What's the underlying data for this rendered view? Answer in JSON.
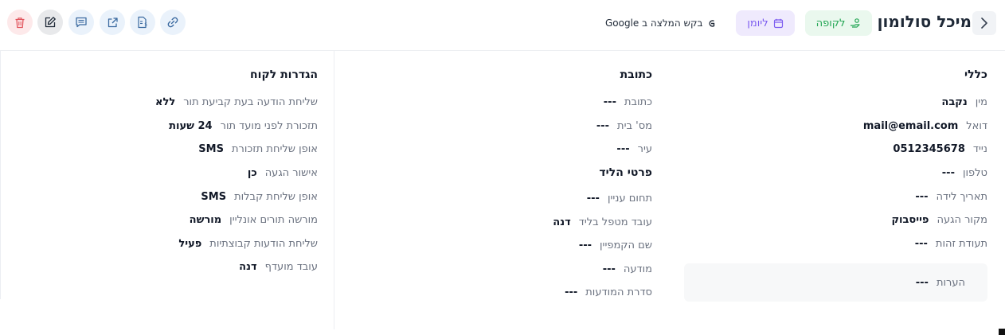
{
  "header": {
    "client_name": "מיכל סולומון",
    "customer_badge": "לקופה",
    "diary_badge": "ליומן",
    "google_request": "בקש המלצה ב Google"
  },
  "general": {
    "title": "כללי",
    "fields": [
      {
        "label": "מין",
        "value": "נקבה"
      },
      {
        "label": "דואל",
        "value": "mail@email.com"
      },
      {
        "label": "נייד",
        "value": "0512345678"
      },
      {
        "label": "טלפון",
        "value": "---"
      },
      {
        "label": "תאריך לידה",
        "value": "---"
      },
      {
        "label": "מקור הגעה",
        "value": "פייסבוק"
      },
      {
        "label": "תעודת זהות",
        "value": "---"
      }
    ],
    "notes_label": "הערות",
    "notes_value": "---"
  },
  "address": {
    "title": "כתובת",
    "fields": [
      {
        "label": "כתובת",
        "value": "---"
      },
      {
        "label": "מס' בית",
        "value": "---"
      },
      {
        "label": "עיר",
        "value": "---"
      }
    ]
  },
  "lead": {
    "title": "פרטי הליד",
    "fields": [
      {
        "label": "תחום עניין",
        "value": "---"
      },
      {
        "label": "עובד מטפל בליד",
        "value": "דנה"
      },
      {
        "label": "שם הקמפיין",
        "value": "---"
      },
      {
        "label": "מודעה",
        "value": "---"
      },
      {
        "label": "סדרת המודעות",
        "value": "---"
      }
    ]
  },
  "settings": {
    "title": "הגדרות לקוח",
    "fields": [
      {
        "label": "שליחת הודעה בעת קביעת תור",
        "value": "ללא"
      },
      {
        "label": "תזכורת לפני מועד תור",
        "value": "24 שעות"
      },
      {
        "label": "אופן שליחת תזכורת",
        "value": "SMS"
      },
      {
        "label": "אישור הגעה",
        "value": "כן"
      },
      {
        "label": "אופן שליחת קבלות",
        "value": "SMS"
      },
      {
        "label": "מורשה תורים אונליין",
        "value": "מורשה"
      },
      {
        "label": "שליחת הודעות קבוצתיות",
        "value": "פעיל"
      },
      {
        "label": "עובד מועדף",
        "value": "דנה"
      }
    ]
  },
  "icons": {
    "back": "chevron-right-icon",
    "customer": "hand-coin-icon",
    "diary": "calendar-icon",
    "google": "google-icon",
    "toolbar": [
      "link-icon",
      "invoice-icon",
      "external-link-icon",
      "message-icon",
      "edit-icon",
      "trash-icon"
    ]
  },
  "colors": {
    "accent_blue": "#3b6aa0",
    "danger": "#e2555e",
    "success": "#22a553",
    "purple": "#7c5cf0"
  }
}
